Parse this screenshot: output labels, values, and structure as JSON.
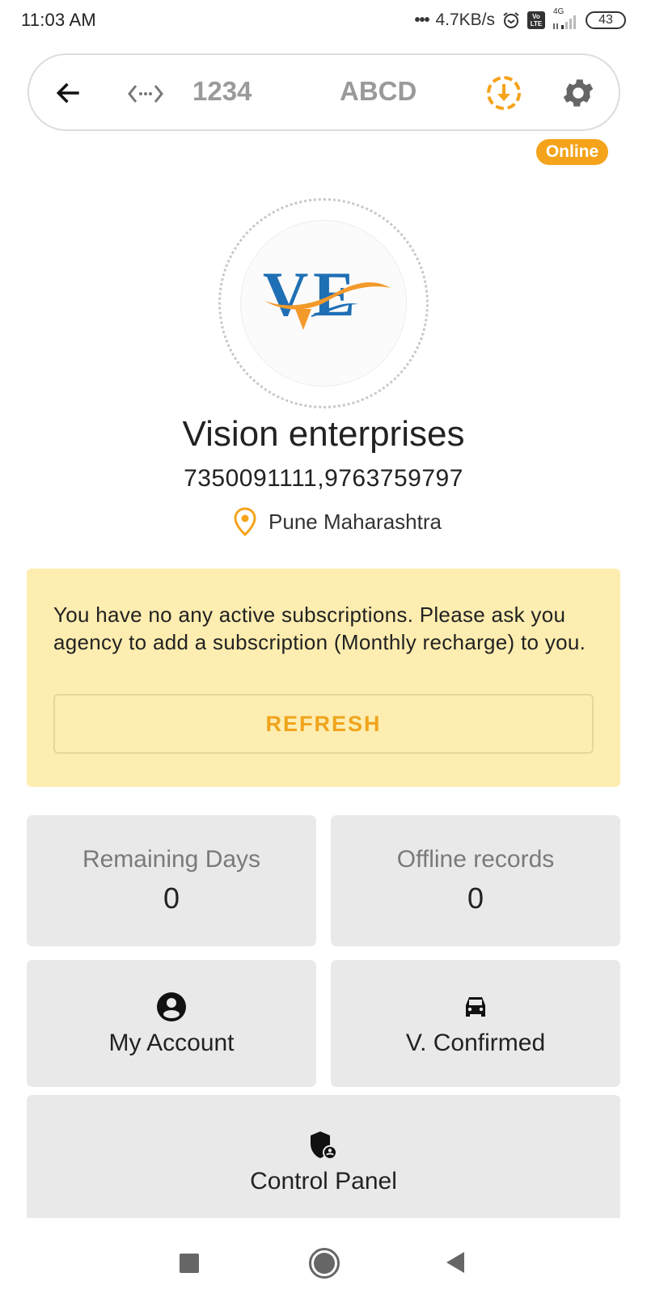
{
  "status_bar": {
    "time": "11:03 AM",
    "network_speed": "4.7KB/s",
    "network_type": "4G",
    "volte_top": "Vo",
    "volte_bottom": "LTE",
    "battery": "43",
    "icons": [
      "alarm-icon",
      "volte-icon",
      "signal-icon",
      "battery-icon"
    ]
  },
  "toolbar": {
    "back_icon": "arrow-left-icon",
    "code_icon": "code-dots-icon",
    "number": "1234",
    "code": "ABCD",
    "download_icon": "download-circle-icon",
    "settings_icon": "gear-icon"
  },
  "status_badge": "Online",
  "company": {
    "logo_text": "VE",
    "name": "Vision enterprises",
    "phones": "7350091111,9763759797",
    "location": "Pune Maharashtra"
  },
  "alert": {
    "message": "You have no any active subscriptions. Please ask you agency to add a subscription (Monthly recharge) to you.",
    "button_label": "REFRESH"
  },
  "stats": [
    {
      "label": "Remaining Days",
      "value": "0"
    },
    {
      "label": "Offline records",
      "value": "0"
    }
  ],
  "actions": [
    {
      "label": "My Account",
      "icon": "account-circle-icon"
    },
    {
      "label": "V. Confirmed",
      "icon": "car-icon"
    },
    {
      "label": "Control Panel",
      "icon": "admin-shield-icon"
    }
  ],
  "colors": {
    "accent": "#f5a31a",
    "alert_bg": "#fdedb0",
    "tile_bg": "#e9e9e9",
    "logo_blue": "#1f6fb5",
    "logo_orange": "#f39a2b"
  },
  "nav": {
    "recent": "recent-apps-icon",
    "home": "home-icon",
    "back": "back-triangle-icon"
  }
}
